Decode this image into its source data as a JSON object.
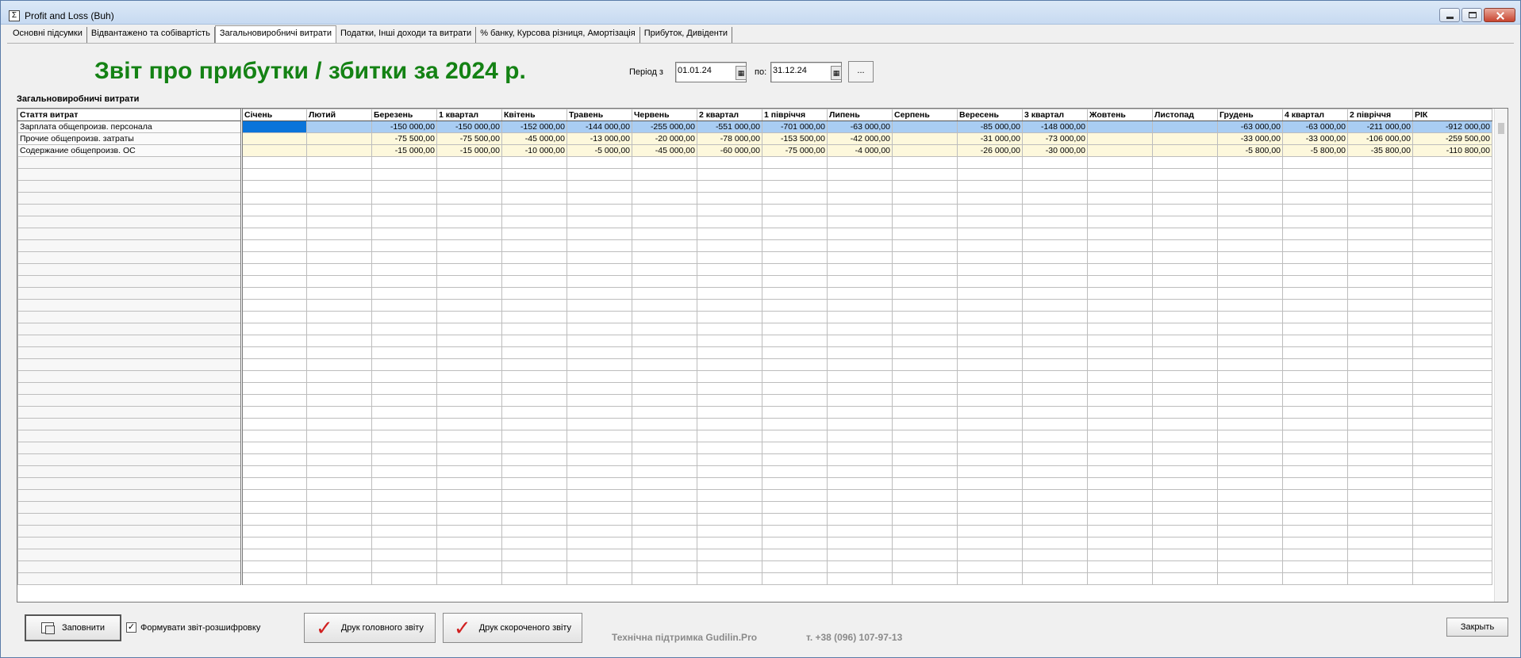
{
  "window": {
    "title": "Profit and Loss (Buh)"
  },
  "tabs": [
    {
      "label": "Основні підсумки"
    },
    {
      "label": "Відвантажено та собівартість"
    },
    {
      "label": "Загальновиробничі витрати",
      "active": true
    },
    {
      "label": "Податки, Інші доходи та витрати"
    },
    {
      "label": "% банку, Курсова різниця, Амортізація"
    },
    {
      "label": "Прибуток, Дивіденти"
    }
  ],
  "header": {
    "report_title": "Звіт про прибутки / збитки за 2024 р.",
    "period_from_label": "Період з",
    "period_from": "01.01.24",
    "period_to_label": "по:",
    "period_to": "31.12.24",
    "more_label": "..."
  },
  "grid": {
    "section_title": "Загальновиробничі витрати",
    "columns": [
      "Стаття витрат",
      "Січень",
      "Лютий",
      "Березень",
      "1 квартал",
      "Квітень",
      "Травень",
      "Червень",
      "2 квартал",
      "1 півріччя",
      "Липень",
      "Серпень",
      "Вересень",
      "3 квартал",
      "Жовтень",
      "Листопад",
      "Грудень",
      "4 квартал",
      "2 півріччя",
      "РІК"
    ],
    "rows": [
      [
        "Зарплата общепроизв. персонала",
        "",
        "",
        "-150 000,00",
        "-150 000,00",
        "-152 000,00",
        "-144 000,00",
        "-255 000,00",
        "-551 000,00",
        "-701 000,00",
        "-63 000,00",
        "",
        "-85 000,00",
        "-148 000,00",
        "",
        "",
        "-63 000,00",
        "-63 000,00",
        "-211 000,00",
        "-912 000,00"
      ],
      [
        "Прочие общепроизв. затраты",
        "",
        "",
        "-75 500,00",
        "-75 500,00",
        "-45 000,00",
        "-13 000,00",
        "-20 000,00",
        "-78 000,00",
        "-153 500,00",
        "-42 000,00",
        "",
        "-31 000,00",
        "-73 000,00",
        "",
        "",
        "-33 000,00",
        "-33 000,00",
        "-106 000,00",
        "-259 500,00"
      ],
      [
        "Содержание общепроизв. ОС",
        "",
        "",
        "-15 000,00",
        "-15 000,00",
        "-10 000,00",
        "-5 000,00",
        "-45 000,00",
        "-60 000,00",
        "-75 000,00",
        "-4 000,00",
        "",
        "-26 000,00",
        "-30 000,00",
        "",
        "",
        "-5 800,00",
        "-5 800,00",
        "-35 800,00",
        "-110 800,00"
      ]
    ]
  },
  "footer": {
    "fill_button": "Заповнити",
    "detail_checkbox_label": "Формувати звіт-розшифровку",
    "detail_checkbox_checked": true,
    "print_main_button": "Друк головного звіту",
    "print_short_button": "Друк скороченого звіту",
    "support_text": "Технічна підтримка Gudilin.Pro",
    "phone_text": "т. +38 (096) 107-97-13",
    "close_button": "Закрыть"
  }
}
